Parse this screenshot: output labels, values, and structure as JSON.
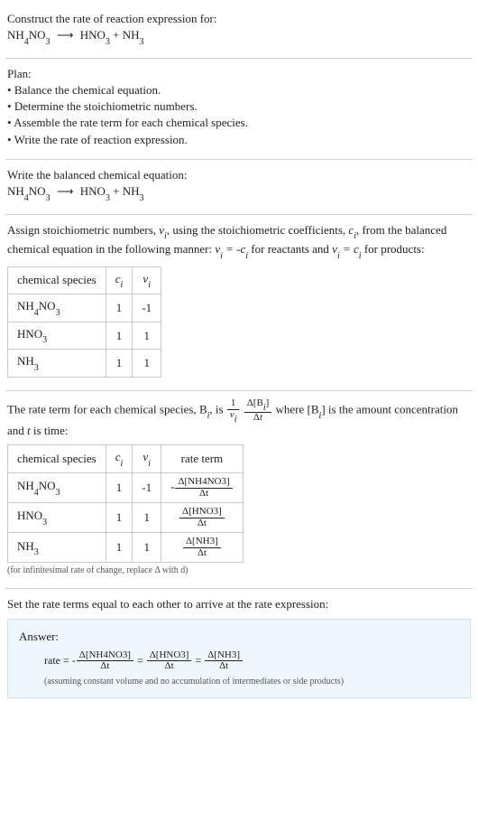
{
  "header": {
    "title": "Construct the rate of reaction expression for:",
    "equation_lhs": "NH",
    "equation": "NH₄NO₃  ⟶  HNO₃ + NH₃"
  },
  "plan": {
    "title": "Plan:",
    "items": [
      "Balance the chemical equation.",
      "Determine the stoichiometric numbers.",
      "Assemble the rate term for each chemical species.",
      "Write the rate of reaction expression."
    ]
  },
  "balanced": {
    "title": "Write the balanced chemical equation:",
    "equation": "NH₄NO₃  ⟶  HNO₃ + NH₃"
  },
  "stoich": {
    "text_a": "Assign stoichiometric numbers, ",
    "text_b": ", using the stoichiometric coefficients, ",
    "text_c": ", from the balanced chemical equation in the following manner: ",
    "text_d": " for reactants and ",
    "text_e": " for products:",
    "nu": "ν",
    "ci": "c",
    "table": {
      "headers": [
        "chemical species",
        "cᵢ",
        "νᵢ"
      ],
      "rows": [
        {
          "species": "NH₄NO₃",
          "c": "1",
          "nu": "-1"
        },
        {
          "species": "HNO₃",
          "c": "1",
          "nu": "1"
        },
        {
          "species": "NH₃",
          "c": "1",
          "nu": "1"
        }
      ]
    }
  },
  "rateterm": {
    "text_a": "The rate term for each chemical species, B",
    "text_b": ", is ",
    "text_c": " where [B",
    "text_d": "] is the amount concentration and ",
    "text_e": " is time:",
    "t_label": "t",
    "table": {
      "headers": [
        "chemical species",
        "cᵢ",
        "νᵢ",
        "rate term"
      ],
      "rows": [
        {
          "species": "NH₄NO₃",
          "c": "1",
          "nu": "-1",
          "rate_num": "Δ[NH4NO3]",
          "rate_den": "Δt",
          "neg": "-"
        },
        {
          "species": "HNO₃",
          "c": "1",
          "nu": "1",
          "rate_num": "Δ[HNO3]",
          "rate_den": "Δt",
          "neg": ""
        },
        {
          "species": "NH₃",
          "c": "1",
          "nu": "1",
          "rate_num": "Δ[NH3]",
          "rate_den": "Δt",
          "neg": ""
        }
      ]
    },
    "footnote": "(for infinitesimal rate of change, replace Δ with d)"
  },
  "final": {
    "intro": "Set the rate terms equal to each other to arrive at the rate expression:",
    "answer_label": "Answer:",
    "rate_prefix": "rate = ",
    "eq_sign": " = ",
    "terms": [
      {
        "neg": "-",
        "num": "Δ[NH4NO3]",
        "den": "Δt"
      },
      {
        "neg": "",
        "num": "Δ[HNO3]",
        "den": "Δt"
      },
      {
        "neg": "",
        "num": "Δ[NH3]",
        "den": "Δt"
      }
    ],
    "assumption": "(assuming constant volume and no accumulation of intermediates or side products)"
  },
  "glyphs": {
    "arrow": "⟶",
    "delta": "Δ",
    "nu": "ν"
  }
}
